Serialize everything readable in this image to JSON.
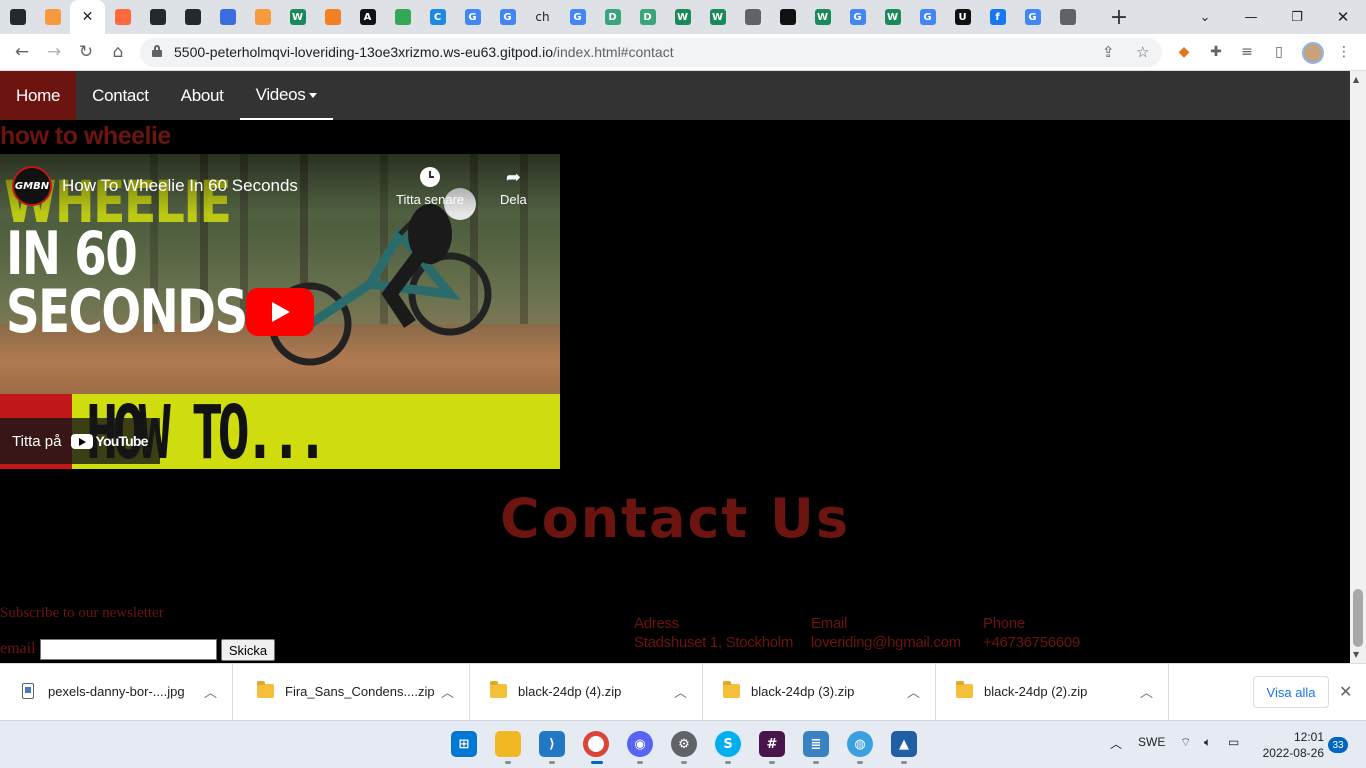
{
  "browser": {
    "tabs": [
      {
        "icon": "github-icon",
        "glyph": "",
        "color": "#24292f"
      },
      {
        "icon": "gitpod-icon",
        "glyph": "",
        "color": "#f79a3e"
      },
      {
        "icon": "close-icon",
        "glyph": "✕",
        "color": "#ffffff",
        "active": true
      },
      {
        "icon": "circle-icon",
        "glyph": "",
        "color": "#ff6a3d"
      },
      {
        "icon": "github-icon",
        "glyph": "",
        "color": "#24292f"
      },
      {
        "icon": "github-icon",
        "glyph": "",
        "color": "#24292f"
      },
      {
        "icon": "app-icon",
        "glyph": "",
        "color": "#3b6ce0"
      },
      {
        "icon": "gitpod-icon",
        "glyph": "",
        "color": "#f79a3e"
      },
      {
        "icon": "w-icon",
        "glyph": "W",
        "color": "#1a8a5a"
      },
      {
        "icon": "stack-icon",
        "glyph": "",
        "color": "#f48024"
      },
      {
        "icon": "a-icon",
        "glyph": "A",
        "color": "#111111"
      },
      {
        "icon": "maps-icon",
        "glyph": "",
        "color": "#34a853"
      },
      {
        "icon": "c-icon",
        "glyph": "C",
        "color": "#1e88e5"
      },
      {
        "icon": "google-icon",
        "glyph": "G",
        "color": "#4285f4"
      },
      {
        "icon": "google-icon",
        "glyph": "G",
        "color": "#4285f4"
      },
      {
        "icon": "ch-icon",
        "glyph": "ch",
        "color": "#ffffff"
      },
      {
        "icon": "google-icon",
        "glyph": "G",
        "color": "#4285f4"
      },
      {
        "icon": "d-icon",
        "glyph": "D",
        "color": "#3aa57a"
      },
      {
        "icon": "d-icon",
        "glyph": "D",
        "color": "#3aa57a"
      },
      {
        "icon": "w-icon",
        "glyph": "W",
        "color": "#1a8a5a"
      },
      {
        "icon": "w-icon",
        "glyph": "W",
        "color": "#1a8a5a"
      },
      {
        "icon": "globe-icon",
        "glyph": "",
        "color": "#5f6368"
      },
      {
        "icon": "codepen-icon",
        "glyph": "",
        "color": "#111111"
      },
      {
        "icon": "w-icon",
        "glyph": "W",
        "color": "#1a8a5a"
      },
      {
        "icon": "google-icon",
        "glyph": "G",
        "color": "#4285f4"
      },
      {
        "icon": "w-icon",
        "glyph": "W",
        "color": "#1a8a5a"
      },
      {
        "icon": "google-icon",
        "glyph": "G",
        "color": "#4285f4"
      },
      {
        "icon": "u-icon",
        "glyph": "U",
        "color": "#111111"
      },
      {
        "icon": "facebook-icon",
        "glyph": "f",
        "color": "#1877f2"
      },
      {
        "icon": "google-icon",
        "glyph": "G",
        "color": "#4285f4"
      },
      {
        "icon": "arrow-icon",
        "glyph": "",
        "color": "#5f6368"
      }
    ],
    "url_host": "5500-peterholmqvi-loveriding-13oe3xrizmo.ws-eu63.gitpod.io",
    "url_path": "/index.html#contact"
  },
  "site": {
    "nav": [
      {
        "label": "Home",
        "active": true
      },
      {
        "label": "Contact"
      },
      {
        "label": "About"
      },
      {
        "label": "Videos",
        "dropdown": true
      }
    ],
    "section_title": "how to wheelie",
    "video": {
      "title": "How To Wheelie In 60 Seconds",
      "channel": "GMBN",
      "watch_later": "Titta senare",
      "share": "Dela",
      "watch_on": "Titta på",
      "youtube": "YouTube",
      "thumb_word1": "WHEELIE",
      "thumb_word2": "IN 60",
      "thumb_word3": "SECONDS",
      "thumb_howto": "HOW TO..."
    },
    "contact_heading": "Contact Us",
    "newsletter": "Subscribe to our newsletter",
    "email_label": "email",
    "email_value": "",
    "submit_label": "Skicka",
    "info": [
      {
        "label": "Adress",
        "value": "Stadshuset 1, Stockholm"
      },
      {
        "label": "Email",
        "value": "loveriding@hgmail.com"
      },
      {
        "label": "Phone",
        "value": "+46736756609"
      }
    ],
    "accent": "#6b1410"
  },
  "downloads": {
    "items": [
      {
        "name": "pexels-danny-bor-....jpg",
        "type": "image"
      },
      {
        "name": "Fira_Sans_Condens....zip",
        "type": "zip"
      },
      {
        "name": "black-24dp (4).zip",
        "type": "zip"
      },
      {
        "name": "black-24dp (3).zip",
        "type": "zip"
      },
      {
        "name": "black-24dp (2).zip",
        "type": "zip"
      }
    ],
    "show_all": "Visa alla"
  },
  "taskbar": {
    "lang": "SWE",
    "time": "12:01",
    "date": "2022-08-26",
    "notifications": "33"
  }
}
